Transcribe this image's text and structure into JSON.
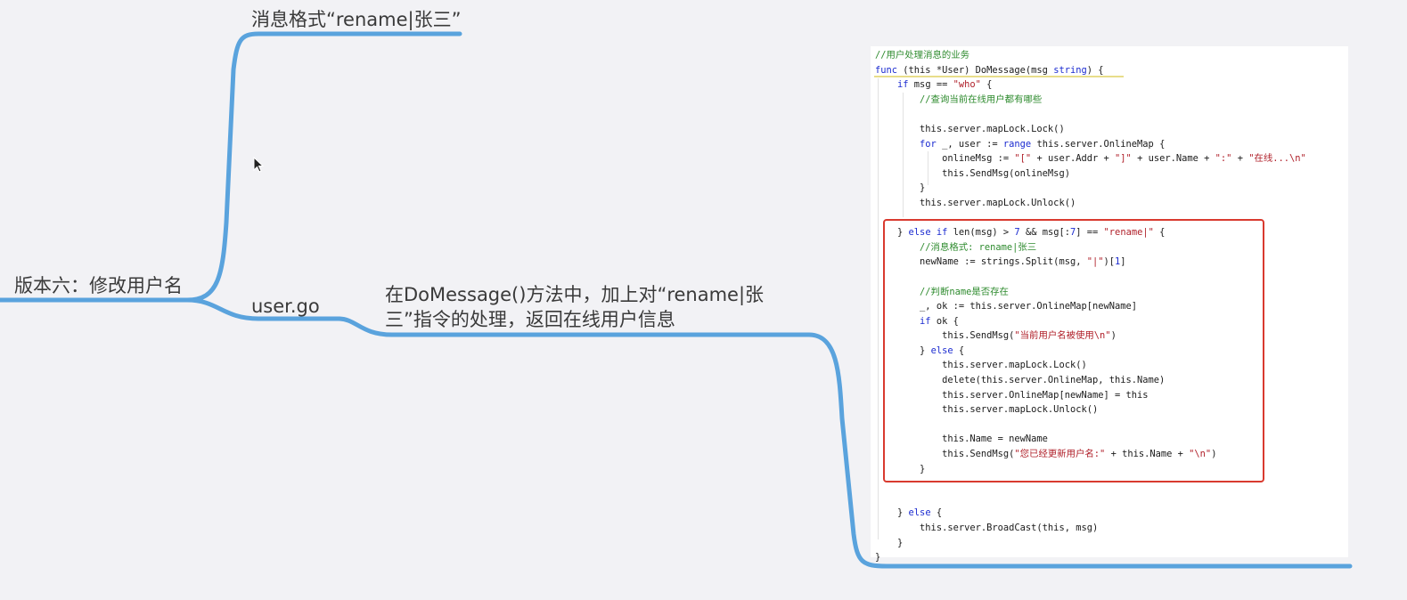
{
  "mindmap": {
    "root": "版本六：修改用户名",
    "branch_top": "消息格式“rename|张三”",
    "branch_file": "user.go",
    "branch_desc": "在DoMessage()方法中，加上对“rename|张三”指令的处理，返回在线用户信息"
  },
  "colors": {
    "branch": "#5aa3dd",
    "highlight_box": "#d93a2f",
    "keyword": "#1b2bd0",
    "string": "#b0202a",
    "comment": "#2e8b2e"
  },
  "code_lines": [
    [
      {
        "t": "//用户处理消息的业务",
        "c": "cmt"
      }
    ],
    [
      {
        "t": "func",
        "c": "kw"
      },
      {
        "t": " (this *User) DoMessage(msg "
      },
      {
        "t": "string",
        "c": "kw"
      },
      {
        "t": ") {"
      }
    ],
    [
      {
        "t": "    "
      },
      {
        "t": "if",
        "c": "kw"
      },
      {
        "t": " msg == "
      },
      {
        "t": "\"who\"",
        "c": "str"
      },
      {
        "t": " {"
      }
    ],
    [
      {
        "t": "        "
      },
      {
        "t": "//查询当前在线用户都有哪些",
        "c": "cmt"
      }
    ],
    [
      {
        "t": ""
      }
    ],
    [
      {
        "t": "        this.server.mapLock.Lock()"
      }
    ],
    [
      {
        "t": "        "
      },
      {
        "t": "for",
        "c": "kw"
      },
      {
        "t": " _, user := "
      },
      {
        "t": "range",
        "c": "kw"
      },
      {
        "t": " this.server.OnlineMap {"
      }
    ],
    [
      {
        "t": "            onlineMsg := "
      },
      {
        "t": "\"[\"",
        "c": "str"
      },
      {
        "t": " + user.Addr + "
      },
      {
        "t": "\"]\"",
        "c": "str"
      },
      {
        "t": " + user.Name + "
      },
      {
        "t": "\":\"",
        "c": "str"
      },
      {
        "t": " + "
      },
      {
        "t": "\"在线...\\n\"",
        "c": "str"
      }
    ],
    [
      {
        "t": "            this.SendMsg(onlineMsg)"
      }
    ],
    [
      {
        "t": "        }"
      }
    ],
    [
      {
        "t": "        this.server.mapLock.Unlock()"
      }
    ],
    [
      {
        "t": ""
      }
    ],
    [
      {
        "t": "    } "
      },
      {
        "t": "else if",
        "c": "kw"
      },
      {
        "t": " len(msg) > "
      },
      {
        "t": "7",
        "c": "num"
      },
      {
        "t": " && msg[:"
      },
      {
        "t": "7",
        "c": "num"
      },
      {
        "t": "] == "
      },
      {
        "t": "\"rename|\"",
        "c": "str"
      },
      {
        "t": " {"
      }
    ],
    [
      {
        "t": "        "
      },
      {
        "t": "//消息格式: rename|张三",
        "c": "cmt"
      }
    ],
    [
      {
        "t": "        newName := strings.Split(msg, "
      },
      {
        "t": "\"|\"",
        "c": "str"
      },
      {
        "t": ")["
      },
      {
        "t": "1",
        "c": "num"
      },
      {
        "t": "]"
      }
    ],
    [
      {
        "t": ""
      }
    ],
    [
      {
        "t": "        "
      },
      {
        "t": "//判断name是否存在",
        "c": "cmt"
      }
    ],
    [
      {
        "t": "        _, ok := this.server.OnlineMap[newName]"
      }
    ],
    [
      {
        "t": "        "
      },
      {
        "t": "if",
        "c": "kw"
      },
      {
        "t": " ok {"
      }
    ],
    [
      {
        "t": "            this.SendMsg("
      },
      {
        "t": "\"当前用户名被使用\\n\"",
        "c": "str"
      },
      {
        "t": ")"
      }
    ],
    [
      {
        "t": "        } "
      },
      {
        "t": "else",
        "c": "kw"
      },
      {
        "t": " {"
      }
    ],
    [
      {
        "t": "            this.server.mapLock.Lock()"
      }
    ],
    [
      {
        "t": "            delete(this.server.OnlineMap, this.Name)"
      }
    ],
    [
      {
        "t": "            this.server.OnlineMap[newName] = this"
      }
    ],
    [
      {
        "t": "            this.server.mapLock.Unlock()"
      }
    ],
    [
      {
        "t": ""
      }
    ],
    [
      {
        "t": "            this.Name = newName"
      }
    ],
    [
      {
        "t": "            this.SendMsg("
      },
      {
        "t": "\"您已经更新用户名:\"",
        "c": "str"
      },
      {
        "t": " + this.Name + "
      },
      {
        "t": "\"\\n\"",
        "c": "str"
      },
      {
        "t": ")"
      }
    ],
    [
      {
        "t": "        }"
      }
    ],
    [
      {
        "t": ""
      }
    ],
    [
      {
        "t": ""
      }
    ],
    [
      {
        "t": "    } "
      },
      {
        "t": "else",
        "c": "kw"
      },
      {
        "t": " {"
      }
    ],
    [
      {
        "t": "        this.server.BroadCast(this, msg)"
      }
    ],
    [
      {
        "t": "    }"
      }
    ],
    [
      {
        "t": "}"
      }
    ]
  ]
}
